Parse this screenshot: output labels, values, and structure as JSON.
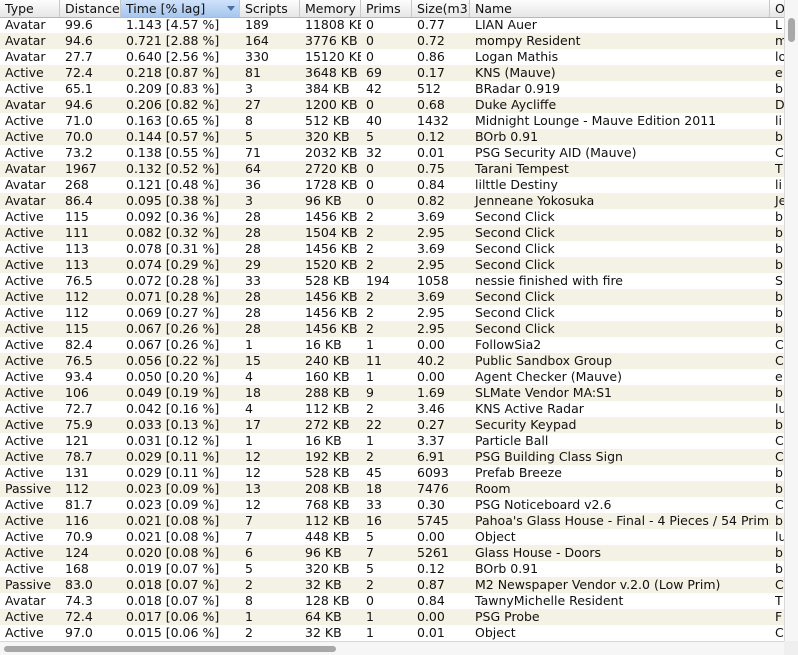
{
  "columns": [
    {
      "key": "type",
      "label": "Type"
    },
    {
      "key": "distance",
      "label": "Distance"
    },
    {
      "key": "time",
      "label": "Time [% lag]",
      "sorted": true
    },
    {
      "key": "scripts",
      "label": "Scripts"
    },
    {
      "key": "memory",
      "label": "Memory"
    },
    {
      "key": "prims",
      "label": "Prims"
    },
    {
      "key": "size",
      "label": "Size(m3)"
    },
    {
      "key": "name",
      "label": "Name"
    },
    {
      "key": "owner",
      "label": "Owner"
    }
  ],
  "rows": [
    [
      "Avatar",
      "99.6",
      "1.143 [4.57 %]",
      "189",
      "11808 KB",
      "0",
      "0.77",
      "LIAN Auer",
      "L"
    ],
    [
      "Avatar",
      "94.6",
      "0.721 [2.88 %]",
      "164",
      "3776 KB",
      "0",
      "0.72",
      "mompy Resident",
      "m"
    ],
    [
      "Avatar",
      "27.7",
      "0.640 [2.56 %]",
      "330",
      "15120 KB",
      "0",
      "0.86",
      "Logan Mathis",
      "lo"
    ],
    [
      "Active",
      "72.4",
      "0.218 [0.87 %]",
      "81",
      "3648 KB",
      "69",
      "0.17",
      "KNS (Mauve)",
      "e"
    ],
    [
      "Active",
      "65.1",
      "0.209 [0.83 %]",
      "3",
      "384 KB",
      "42",
      "512",
      "BRadar 0.919",
      "b"
    ],
    [
      "Avatar",
      "94.6",
      "0.206 [0.82 %]",
      "27",
      "1200 KB",
      "0",
      "0.68",
      "Duke Aycliffe",
      "D"
    ],
    [
      "Active",
      "71.0",
      "0.163 [0.65 %]",
      "8",
      "512 KB",
      "40",
      "1432",
      "Midnight Lounge - Mauve Edition 2011",
      "li"
    ],
    [
      "Active",
      "70.0",
      "0.144 [0.57 %]",
      "5",
      "320 KB",
      "5",
      "0.12",
      "BOrb 0.91",
      "b"
    ],
    [
      "Active",
      "73.2",
      "0.138 [0.55 %]",
      "71",
      "2032 KB",
      "32",
      "0.01",
      "PSG Security AID (Mauve)",
      "C"
    ],
    [
      "Avatar",
      "1967",
      "0.132 [0.52 %]",
      "64",
      "2720 KB",
      "0",
      "0.75",
      "Tarani Tempest",
      "T"
    ],
    [
      "Avatar",
      "268",
      "0.121 [0.48 %]",
      "36",
      "1728 KB",
      "0",
      "0.84",
      "lilttle Destiny",
      "li"
    ],
    [
      "Avatar",
      "86.4",
      "0.095 [0.38 %]",
      "3",
      "96 KB",
      "0",
      "0.82",
      "Jenneane Yokosuka",
      "Je"
    ],
    [
      "Active",
      "115",
      "0.092 [0.36 %]",
      "28",
      "1456 KB",
      "2",
      "3.69",
      "Second Click",
      "b"
    ],
    [
      "Active",
      "111",
      "0.082 [0.32 %]",
      "28",
      "1504 KB",
      "2",
      "2.95",
      "Second Click",
      "b"
    ],
    [
      "Active",
      "113",
      "0.078 [0.31 %]",
      "28",
      "1456 KB",
      "2",
      "3.69",
      "Second Click",
      "b"
    ],
    [
      "Active",
      "113",
      "0.074 [0.29 %]",
      "29",
      "1520 KB",
      "2",
      "2.95",
      "Second Click",
      "b"
    ],
    [
      "Active",
      "76.5",
      "0.072 [0.28 %]",
      "33",
      "528 KB",
      "194",
      "1058",
      "nessie finished with fire",
      "S"
    ],
    [
      "Active",
      "112",
      "0.071 [0.28 %]",
      "28",
      "1456 KB",
      "2",
      "3.69",
      "Second Click",
      "b"
    ],
    [
      "Active",
      "112",
      "0.069 [0.27 %]",
      "28",
      "1456 KB",
      "2",
      "2.95",
      "Second Click",
      "b"
    ],
    [
      "Active",
      "115",
      "0.067 [0.26 %]",
      "28",
      "1456 KB",
      "2",
      "2.95",
      "Second Click",
      "b"
    ],
    [
      "Active",
      "82.4",
      "0.067 [0.26 %]",
      "1",
      "16 KB",
      "1",
      "0.00",
      "FollowSia2",
      "C"
    ],
    [
      "Active",
      "76.5",
      "0.056 [0.22 %]",
      "15",
      "240 KB",
      "11",
      "40.2",
      "Public Sandbox Group",
      "C"
    ],
    [
      "Active",
      "93.4",
      "0.050 [0.20 %]",
      "4",
      "160 KB",
      "1",
      "0.00",
      "Agent Checker (Mauve)",
      "e"
    ],
    [
      "Active",
      "106",
      "0.049 [0.19 %]",
      "18",
      "288 KB",
      "9",
      "1.69",
      "SLMate Vendor MA:S1",
      "b"
    ],
    [
      "Active",
      "72.7",
      "0.042 [0.16 %]",
      "4",
      "112 KB",
      "2",
      "3.46",
      "KNS Active Radar",
      "lu"
    ],
    [
      "Active",
      "75.9",
      "0.033 [0.13 %]",
      "17",
      "272 KB",
      "22",
      "0.27",
      "Security Keypad",
      "b"
    ],
    [
      "Active",
      "121",
      "0.031 [0.12 %]",
      "1",
      "16 KB",
      "1",
      "3.37",
      "Particle Ball",
      "C"
    ],
    [
      "Active",
      "78.7",
      "0.029 [0.11 %]",
      "12",
      "192 KB",
      "2",
      "6.91",
      "PSG Building Class Sign",
      "C"
    ],
    [
      "Active",
      "131",
      "0.029 [0.11 %]",
      "12",
      "528 KB",
      "45",
      "6093",
      "Prefab Breeze",
      "b"
    ],
    [
      "Passive",
      "112",
      "0.023 [0.09 %]",
      "13",
      "208 KB",
      "18",
      "7476",
      "Room",
      "b"
    ],
    [
      "Active",
      "81.7",
      "0.023 [0.09 %]",
      "12",
      "768 KB",
      "33",
      "0.30",
      "PSG Noticeboard v2.6",
      "C"
    ],
    [
      "Active",
      "116",
      "0.021 [0.08 %]",
      "7",
      "112 KB",
      "16",
      "5745",
      "Pahoa's Glass House - Final - 4 Pieces / 54 Prims",
      "b"
    ],
    [
      "Active",
      "70.9",
      "0.021 [0.08 %]",
      "7",
      "448 KB",
      "5",
      "0.00",
      "Object",
      "lu"
    ],
    [
      "Active",
      "124",
      "0.020 [0.08 %]",
      "6",
      "96 KB",
      "7",
      "5261",
      "Glass House - Doors",
      "b"
    ],
    [
      "Active",
      "168",
      "0.019 [0.07 %]",
      "5",
      "320 KB",
      "5",
      "0.12",
      "BOrb 0.91",
      "b"
    ],
    [
      "Passive",
      "83.0",
      "0.018 [0.07 %]",
      "2",
      "32 KB",
      "2",
      "0.87",
      "M2 Newspaper Vendor v.2.0 (Low Prim)",
      "C"
    ],
    [
      "Avatar",
      "74.3",
      "0.018 [0.07 %]",
      "8",
      "128 KB",
      "0",
      "0.84",
      "TawnyMichelle Resident",
      "T"
    ],
    [
      "Active",
      "72.4",
      "0.017 [0.06 %]",
      "1",
      "64 KB",
      "1",
      "0.00",
      "PSG Probe",
      "F"
    ],
    [
      "Active",
      "97.0",
      "0.015 [0.06 %]",
      "2",
      "32 KB",
      "1",
      "0.01",
      "Object",
      "C"
    ]
  ]
}
